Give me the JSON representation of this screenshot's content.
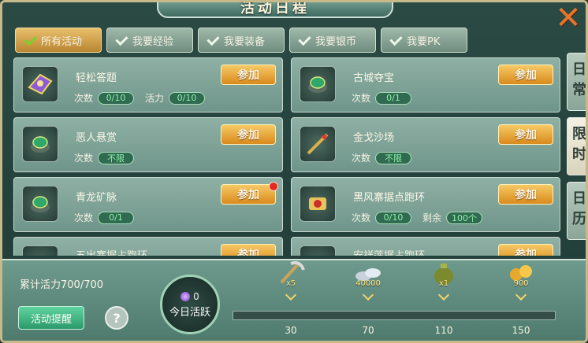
{
  "window": {
    "title": "活动日程"
  },
  "tabs": [
    {
      "label": "所有活动",
      "active": true
    },
    {
      "label": "我要经验",
      "active": false
    },
    {
      "label": "我要装备",
      "active": false
    },
    {
      "label": "我要银币",
      "active": false
    },
    {
      "label": "我要PK",
      "active": false
    }
  ],
  "activities": [
    {
      "name": "轻松答题",
      "icon": "book-icon",
      "count_label": "次数",
      "count": "0/10",
      "extra_label": "活力",
      "extra": "0/10",
      "button": "参加",
      "notify": false
    },
    {
      "name": "古城夺宝",
      "icon": "jade-bowl-icon",
      "count_label": "次数",
      "count": "0/1",
      "button": "参加",
      "notify": false
    },
    {
      "name": "恶人悬赏",
      "icon": "jade-bowl-icon",
      "count_label": "次数",
      "count": "不限",
      "button": "参加",
      "notify": false
    },
    {
      "name": "金戈沙场",
      "icon": "spear-icon",
      "count_label": "次数",
      "count": "不限",
      "button": "参加",
      "notify": false
    },
    {
      "name": "青龙矿脉",
      "icon": "jade-bowl-icon",
      "count_label": "次数",
      "count": "0/1",
      "button": "参加",
      "notify": true
    },
    {
      "name": "黑风寨据点跑环",
      "icon": "scroll-icon",
      "count_label": "次数",
      "count": "0/10",
      "extra_label": "剩余",
      "extra": "100个",
      "button": "参加",
      "notify": false
    },
    {
      "name": "五出寨据占跑环",
      "icon": "sun-icon",
      "button": "参加"
    },
    {
      "name": "安祥莲据占跑环",
      "icon": "sun-icon",
      "button": "参加"
    }
  ],
  "side_tabs": [
    {
      "label": "日常",
      "active": false
    },
    {
      "label": "限时",
      "active": true
    },
    {
      "label": "日历",
      "active": false
    }
  ],
  "bottom": {
    "vitality_text": "累计活力700/700",
    "remind_button": "活动提醒",
    "help_label": "?",
    "today_value": "0",
    "today_label": "今日活跃",
    "progress_fraction": 0.0,
    "rewards": [
      {
        "icon": "pickaxe-icon",
        "count": "x5",
        "milestone": "30"
      },
      {
        "icon": "silver-icon",
        "count": "40000",
        "milestone": "70"
      },
      {
        "icon": "money-bag-icon",
        "count": "x1",
        "milestone": "110"
      },
      {
        "icon": "gold-coins-icon",
        "count": "900",
        "milestone": "150"
      }
    ]
  },
  "colors": {
    "accent_gold": "#e3c05b",
    "panel_green": "#6f958a",
    "close_orange": "#e8742a"
  }
}
